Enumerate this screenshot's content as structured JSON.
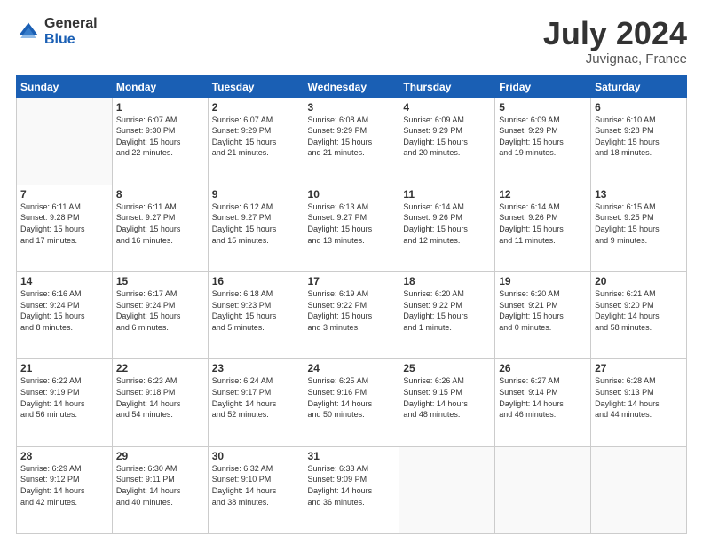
{
  "logo": {
    "general": "General",
    "blue": "Blue"
  },
  "title": {
    "month": "July 2024",
    "location": "Juvignac, France"
  },
  "weekdays": [
    "Sunday",
    "Monday",
    "Tuesday",
    "Wednesday",
    "Thursday",
    "Friday",
    "Saturday"
  ],
  "weeks": [
    [
      {
        "day": "",
        "info": ""
      },
      {
        "day": "1",
        "info": "Sunrise: 6:07 AM\nSunset: 9:30 PM\nDaylight: 15 hours\nand 22 minutes."
      },
      {
        "day": "2",
        "info": "Sunrise: 6:07 AM\nSunset: 9:29 PM\nDaylight: 15 hours\nand 21 minutes."
      },
      {
        "day": "3",
        "info": "Sunrise: 6:08 AM\nSunset: 9:29 PM\nDaylight: 15 hours\nand 21 minutes."
      },
      {
        "day": "4",
        "info": "Sunrise: 6:09 AM\nSunset: 9:29 PM\nDaylight: 15 hours\nand 20 minutes."
      },
      {
        "day": "5",
        "info": "Sunrise: 6:09 AM\nSunset: 9:29 PM\nDaylight: 15 hours\nand 19 minutes."
      },
      {
        "day": "6",
        "info": "Sunrise: 6:10 AM\nSunset: 9:28 PM\nDaylight: 15 hours\nand 18 minutes."
      }
    ],
    [
      {
        "day": "7",
        "info": "Sunrise: 6:11 AM\nSunset: 9:28 PM\nDaylight: 15 hours\nand 17 minutes."
      },
      {
        "day": "8",
        "info": "Sunrise: 6:11 AM\nSunset: 9:27 PM\nDaylight: 15 hours\nand 16 minutes."
      },
      {
        "day": "9",
        "info": "Sunrise: 6:12 AM\nSunset: 9:27 PM\nDaylight: 15 hours\nand 15 minutes."
      },
      {
        "day": "10",
        "info": "Sunrise: 6:13 AM\nSunset: 9:27 PM\nDaylight: 15 hours\nand 13 minutes."
      },
      {
        "day": "11",
        "info": "Sunrise: 6:14 AM\nSunset: 9:26 PM\nDaylight: 15 hours\nand 12 minutes."
      },
      {
        "day": "12",
        "info": "Sunrise: 6:14 AM\nSunset: 9:26 PM\nDaylight: 15 hours\nand 11 minutes."
      },
      {
        "day": "13",
        "info": "Sunrise: 6:15 AM\nSunset: 9:25 PM\nDaylight: 15 hours\nand 9 minutes."
      }
    ],
    [
      {
        "day": "14",
        "info": "Sunrise: 6:16 AM\nSunset: 9:24 PM\nDaylight: 15 hours\nand 8 minutes."
      },
      {
        "day": "15",
        "info": "Sunrise: 6:17 AM\nSunset: 9:24 PM\nDaylight: 15 hours\nand 6 minutes."
      },
      {
        "day": "16",
        "info": "Sunrise: 6:18 AM\nSunset: 9:23 PM\nDaylight: 15 hours\nand 5 minutes."
      },
      {
        "day": "17",
        "info": "Sunrise: 6:19 AM\nSunset: 9:22 PM\nDaylight: 15 hours\nand 3 minutes."
      },
      {
        "day": "18",
        "info": "Sunrise: 6:20 AM\nSunset: 9:22 PM\nDaylight: 15 hours\nand 1 minute."
      },
      {
        "day": "19",
        "info": "Sunrise: 6:20 AM\nSunset: 9:21 PM\nDaylight: 15 hours\nand 0 minutes."
      },
      {
        "day": "20",
        "info": "Sunrise: 6:21 AM\nSunset: 9:20 PM\nDaylight: 14 hours\nand 58 minutes."
      }
    ],
    [
      {
        "day": "21",
        "info": "Sunrise: 6:22 AM\nSunset: 9:19 PM\nDaylight: 14 hours\nand 56 minutes."
      },
      {
        "day": "22",
        "info": "Sunrise: 6:23 AM\nSunset: 9:18 PM\nDaylight: 14 hours\nand 54 minutes."
      },
      {
        "day": "23",
        "info": "Sunrise: 6:24 AM\nSunset: 9:17 PM\nDaylight: 14 hours\nand 52 minutes."
      },
      {
        "day": "24",
        "info": "Sunrise: 6:25 AM\nSunset: 9:16 PM\nDaylight: 14 hours\nand 50 minutes."
      },
      {
        "day": "25",
        "info": "Sunrise: 6:26 AM\nSunset: 9:15 PM\nDaylight: 14 hours\nand 48 minutes."
      },
      {
        "day": "26",
        "info": "Sunrise: 6:27 AM\nSunset: 9:14 PM\nDaylight: 14 hours\nand 46 minutes."
      },
      {
        "day": "27",
        "info": "Sunrise: 6:28 AM\nSunset: 9:13 PM\nDaylight: 14 hours\nand 44 minutes."
      }
    ],
    [
      {
        "day": "28",
        "info": "Sunrise: 6:29 AM\nSunset: 9:12 PM\nDaylight: 14 hours\nand 42 minutes."
      },
      {
        "day": "29",
        "info": "Sunrise: 6:30 AM\nSunset: 9:11 PM\nDaylight: 14 hours\nand 40 minutes."
      },
      {
        "day": "30",
        "info": "Sunrise: 6:32 AM\nSunset: 9:10 PM\nDaylight: 14 hours\nand 38 minutes."
      },
      {
        "day": "31",
        "info": "Sunrise: 6:33 AM\nSunset: 9:09 PM\nDaylight: 14 hours\nand 36 minutes."
      },
      {
        "day": "",
        "info": ""
      },
      {
        "day": "",
        "info": ""
      },
      {
        "day": "",
        "info": ""
      }
    ]
  ]
}
